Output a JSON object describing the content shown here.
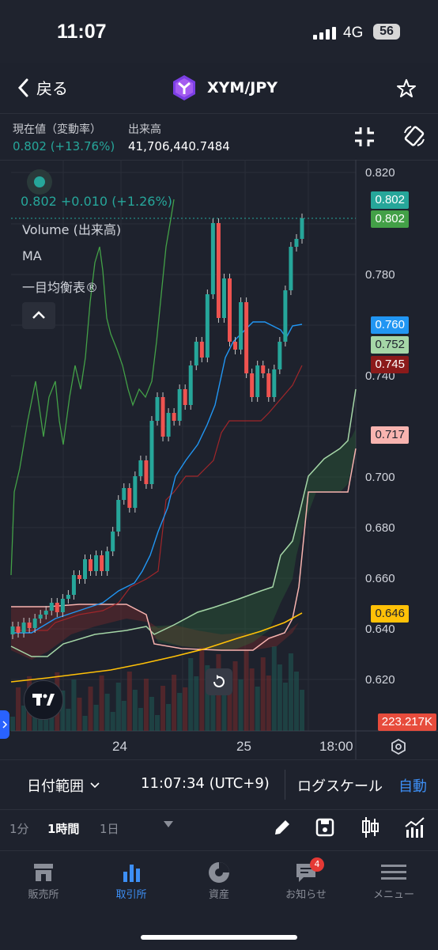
{
  "status": {
    "time": "11:07",
    "network": "4G",
    "battery": "56"
  },
  "header": {
    "back_label": "戻る",
    "pair": "XYM/JPY"
  },
  "info": {
    "price_label": "現在値（変動率）",
    "price_value": "0.802 (+13.76%)",
    "volume_label": "出来高",
    "volume_value": "41,706,440.7484"
  },
  "legend": {
    "change": "0.802  +0.010 (+1.26%)",
    "volume": "Volume (出来高)",
    "ma": "MA",
    "ichimoku": "一目均衡表®"
  },
  "price_axis": {
    "ticks": [
      "0.820",
      "0.780",
      "0.740",
      "0.720",
      "0.700",
      "0.680",
      "0.660",
      "0.640",
      "0.620"
    ],
    "labels": [
      {
        "text": "0.802",
        "color": "#26a69a"
      },
      {
        "text": "0.802",
        "color": "#43a047"
      },
      {
        "text": "0.760",
        "color": "#2196f3"
      },
      {
        "text": "0.752",
        "color": "#a5d6a7"
      },
      {
        "text": "0.745",
        "color": "#8b1a1a"
      },
      {
        "text": "0.717",
        "color": "#f8b4b0"
      },
      {
        "text": "0.646",
        "color": "#ffc107"
      },
      {
        "text": "223.217K",
        "color": "#e74c3c"
      }
    ]
  },
  "time_axis": {
    "ticks": [
      "24",
      "25",
      "18:00"
    ]
  },
  "toolbar": {
    "date_range": "日付範囲",
    "clock": "11:07:34 (UTC+9)",
    "log_scale": "ログスケール",
    "auto": "自動"
  },
  "timeframes": {
    "items": [
      "1分",
      "1時間",
      "1日"
    ],
    "active": "1時間"
  },
  "tabs": [
    {
      "label": "販売所",
      "icon": "store-icon"
    },
    {
      "label": "取引所",
      "icon": "bar-chart-icon"
    },
    {
      "label": "資産",
      "icon": "pie-chart-icon"
    },
    {
      "label": "お知らせ",
      "icon": "message-icon",
      "badge": "4"
    },
    {
      "label": "メニュー",
      "icon": "menu-icon"
    }
  ]
}
